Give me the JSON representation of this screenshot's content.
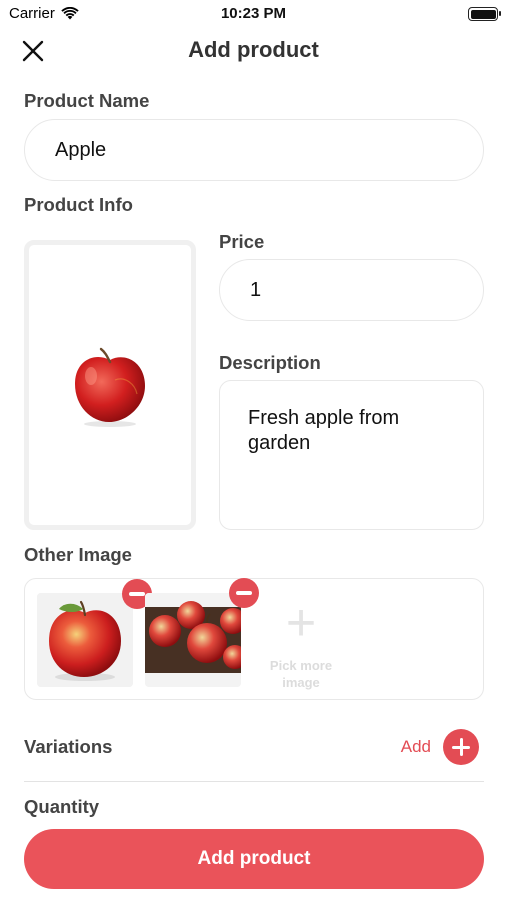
{
  "status_bar": {
    "carrier": "Carrier",
    "time": "10:23 PM",
    "wifi_icon": "wifi-icon",
    "battery_icon": "battery-icon"
  },
  "header": {
    "title": "Add product",
    "close_icon": "close-icon"
  },
  "product_name": {
    "label": "Product Name",
    "value": "Apple"
  },
  "product_info": {
    "label": "Product Info",
    "main_image": "apple-image",
    "price": {
      "label": "Price",
      "value": "1"
    },
    "description": {
      "label": "Description",
      "value": "Fresh apple from garden"
    }
  },
  "other_image": {
    "label": "Other Image",
    "images": [
      "apple-image",
      "apples-on-table-image"
    ],
    "pick_more_label": "Pick more image"
  },
  "variations": {
    "label": "Variations",
    "add_label": "Add"
  },
  "quantity": {
    "label": "Quantity"
  },
  "submit_label": "Add product",
  "colors": {
    "accent": "#e34c54",
    "button": "#ea535a",
    "label_text": "#444444",
    "border": "#e8e8e8"
  }
}
